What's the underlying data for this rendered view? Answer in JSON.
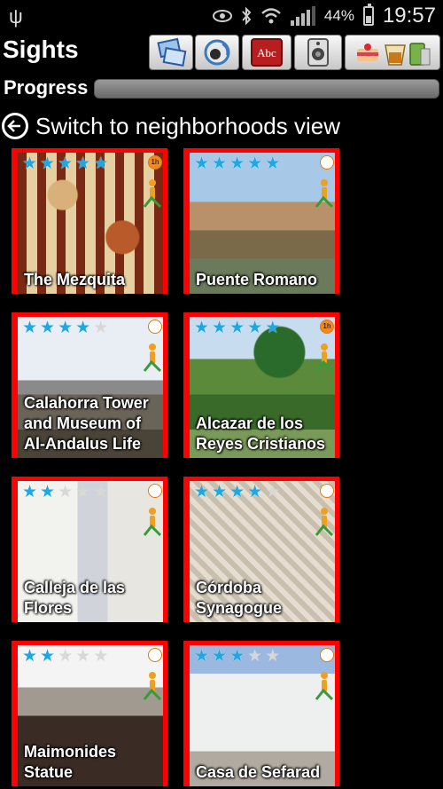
{
  "status_bar": {
    "battery": "44%",
    "time": "19:57",
    "usb_icon": "usb-icon",
    "eye_icon": "eye-icon",
    "bluetooth_icon": "bluetooth-icon",
    "wifi_icon": "wifi-icon",
    "signal_icon": "signal-icon"
  },
  "header": {
    "title": "Sights"
  },
  "toolbar": {
    "buttons": [
      {
        "icon": "view-toggle-icon"
      },
      {
        "icon": "audio-guide-icon"
      },
      {
        "icon": "phrasebook-icon"
      },
      {
        "icon": "speaker-icon"
      },
      {
        "icon": "food-drink-icon"
      }
    ]
  },
  "progress": {
    "label": "Progress",
    "value": 0.0
  },
  "switch_view": {
    "label": "Switch to neighborhoods view"
  },
  "colors": {
    "accent_red": "#ff0000",
    "star_blue": "#1fa7e0",
    "progress_track": "#808080"
  },
  "sights": [
    {
      "name": "The Mezquita",
      "rating": 5,
      "duration": "1h"
    },
    {
      "name": "Puente Romano",
      "rating": 5,
      "duration": ""
    },
    {
      "name": "Calahorra Tower and Museum of Al-Andalus Life",
      "rating": 4,
      "duration": ""
    },
    {
      "name": "Alcazar de los Reyes Cristianos",
      "rating": 5,
      "duration": "1h"
    },
    {
      "name": "Calleja de las Flores",
      "rating": 2,
      "duration": ""
    },
    {
      "name": "Córdoba Synagogue",
      "rating": 4,
      "duration": ""
    },
    {
      "name": "Maimonides Statue",
      "rating": 2,
      "duration": ""
    },
    {
      "name": "Casa de Sefarad",
      "rating": 3,
      "duration": ""
    }
  ]
}
